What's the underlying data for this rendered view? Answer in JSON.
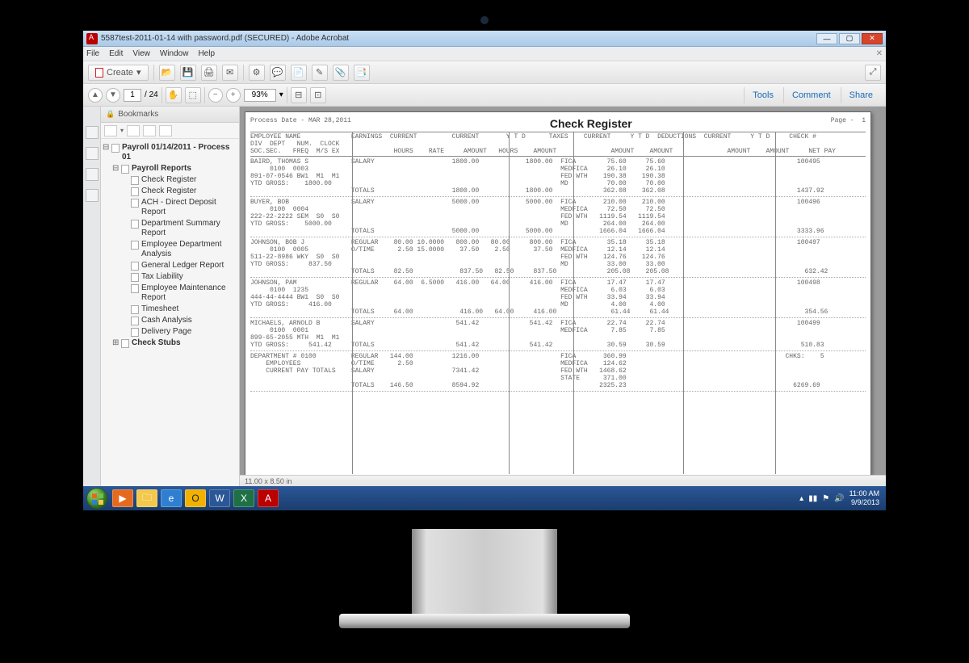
{
  "window": {
    "title": "5587test-2011-01-14 with password.pdf (SECURED) - Adobe Acrobat"
  },
  "menubar": [
    "File",
    "Edit",
    "View",
    "Window",
    "Help"
  ],
  "toolbar": {
    "create_label": "Create",
    "page_current": "1",
    "page_total": "24",
    "zoom": "93%",
    "tools": "Tools",
    "comment": "Comment",
    "share": "Share"
  },
  "bookmarks": {
    "header": "Bookmarks",
    "root": "Payroll 01/14/2011 - Process 01",
    "section": "Payroll Reports",
    "items": [
      "Check Register",
      "Check Register",
      "ACH - Direct Deposit Report",
      "Department Summary Report",
      "Employee Department Analysis",
      "General Ledger Report",
      "Tax Liability",
      "Employee Maintenance Report",
      "Timesheet",
      "Cash Analysis",
      "Delivery Page"
    ],
    "next_section": "Check Stubs"
  },
  "doc": {
    "process_date": "Process Date - MAR 28,2011",
    "title": "Check Register",
    "page_label": "Page -",
    "page_num": "1",
    "page_size": "11.00 x 8.50 in",
    "col_head_1": "EMPLOYEE NAME             EARNINGS  CURRENT         CURRENT       Y T D      TAXES    CURRENT     Y T D  DEDUCTIONS  CURRENT     Y T D     CHECK #",
    "col_head_2": "DIV  DEPT   NUM.  CLOCK",
    "col_head_3": "SOC.SEC.   FREQ  M/S EX              HOURS    RATE     AMOUNT   HOURS    AMOUNT              AMOUNT    AMOUNT              AMOUNT    AMOUNT     NET PAY",
    "employees": [
      {
        "l1": "BAIRD, THOMAS S           SALARY                    1800.00            1800.00  FICA        75.60     75.60                                  100495",
        "l2": "     0100  0003                                                                 MEDFICA     26.10     26.10",
        "l3": "891-07-0546 BW1  M1  M1                                                         FED WTH    190.38    190.38",
        "l4": "YTD GROSS:    1800.00                                                           MD          70.00     70.00",
        "tot": "                          TOTALS                    1800.00            1800.00             362.08    362.08                                  1437.92"
      },
      {
        "l1": "BUYER, BOB                SALARY                    5000.00            5000.00  FICA       210.00    210.00                                  100496",
        "l2": "     0100  0004                                                                 MEDFICA     72.50     72.50",
        "l3": "222-22-2222 SEM  S0  S0                                                         FED WTH   1119.54   1119.54",
        "l4": "YTD GROSS:    5000.00                                                           MD         264.00    264.00",
        "tot": "                          TOTALS                    5000.00            5000.00            1666.04   1666.04                                  3333.96"
      },
      {
        "l1": "JOHNSON, BOB J            REGULAR    80.00 10.0000   800.00   80.00     800.00  FICA        35.18     35.18                                  100497",
        "l2": "     0100  0005           O/TIME      2.50 15.0000    37.50    2.50      37.50  MEDFICA     12.14     12.14",
        "l3": "511-22-8986 WKY  S0  S0                                                         FED WTH    124.76    124.76",
        "l4": "YTD GROSS:     837.50                                                           MD          33.00     33.00",
        "tot": "                          TOTALS     82.50            837.50   82.50     837.50             205.08    205.08                                   632.42"
      },
      {
        "l1": "JOHNSON, PAM              REGULAR    64.00  6.5000   416.00   64.00     416.00  FICA        17.47     17.47                                  100498",
        "l2": "     0100  1235                                                                 MEDFICA      6.03      6.03",
        "l3": "444-44-4444 BW1  S0  S0                                                         FED WTH     33.94     33.94",
        "l4": "YTD GROSS:     416.00                                                           MD           4.00      4.00",
        "tot": "                          TOTALS     64.00            416.00   64.00     416.00              61.44     61.44                                   354.56"
      },
      {
        "l1": "MICHAELS, ARNOLD B        SALARY                     541.42             541.42  FICA        22.74     22.74                                  100499",
        "l2": "     0100  0001                                                                 MEDFICA      7.85      7.85",
        "l3": "899-65-2055 MTH  M1  M1",
        "l4": "YTD GROSS:     541.42     TOTALS                     541.42             541.42              30.59     30.59                                   510.83",
        "tot": ""
      },
      {
        "l1": "DEPARTMENT # 0100         REGULAR   144.00          1216.00                     FICA       360.99                                         CHKS:    5",
        "l2": "    EMPLOYEES             O/TIME      2.50                                      MEDFICA    124.62",
        "l3": "    CURRENT PAY TOTALS    SALARY                    7341.42                     FED WTH   1468.62",
        "l4": "                                                                                STATE      371.00",
        "tot": "                          TOTALS    146.50          8594.92                               2325.23                                           6269.69"
      }
    ]
  },
  "taskbar": {
    "time": "11:00 AM",
    "date": "9/9/2013"
  }
}
